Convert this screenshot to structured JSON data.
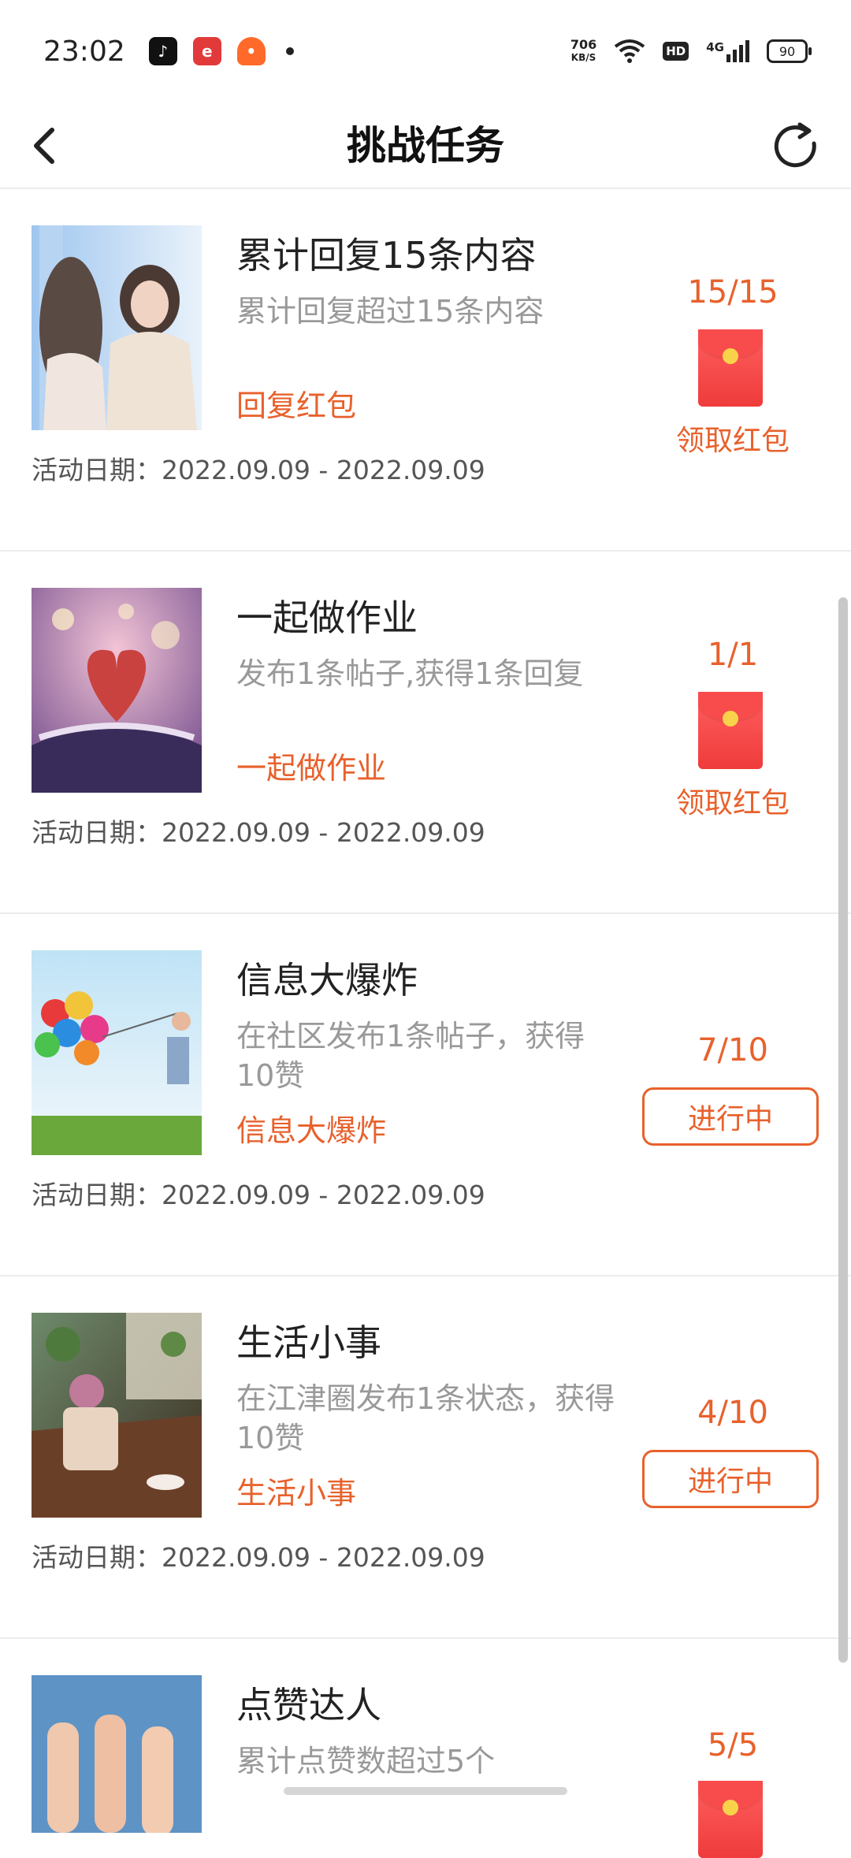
{
  "status_bar": {
    "time": "23:02",
    "app_icons": [
      "tiktok-icon",
      "red-e-app-icon",
      "orange-robot-app-icon"
    ],
    "net_speed_value": "706",
    "net_speed_unit": "KB/S",
    "hd": "HD",
    "network": "4G",
    "battery": "90"
  },
  "header": {
    "title": "挑战任务",
    "back_icon": "chevron-left-icon",
    "refresh_icon": "refresh-icon"
  },
  "tasks": [
    {
      "name": "累计回复15条内容",
      "desc": "累计回复超过15条内容",
      "tag": "回复红包",
      "date": "活动日期：2022.09.09 - 2022.09.09",
      "progress": "15/15",
      "action": "领取红包",
      "state": "claim"
    },
    {
      "name": "一起做作业",
      "desc": "发布1条帖子,获得1条回复",
      "tag": "一起做作业",
      "date": "活动日期：2022.09.09 - 2022.09.09",
      "progress": "1/1",
      "action": "领取红包",
      "state": "claim"
    },
    {
      "name": "信息大爆炸",
      "desc": "在社区发布1条帖子，获得10赞",
      "tag": "信息大爆炸",
      "date": "活动日期：2022.09.09 - 2022.09.09",
      "progress": "7/10",
      "action": "进行中",
      "state": "ongoing"
    },
    {
      "name": "生活小事",
      "desc": "在江津圈发布1条状态，获得10赞",
      "tag": "生活小事",
      "date": "活动日期：2022.09.09 - 2022.09.09",
      "progress": "4/10",
      "action": "进行中",
      "state": "ongoing"
    },
    {
      "name": "点赞达人",
      "desc": "累计点赞数超过5个",
      "tag": "",
      "date": "",
      "progress": "5/5",
      "action": "",
      "state": "claim"
    }
  ],
  "colors": {
    "accent": "#e8612c",
    "envelope": "#ef3b3b",
    "secondary_text": "#999999"
  }
}
